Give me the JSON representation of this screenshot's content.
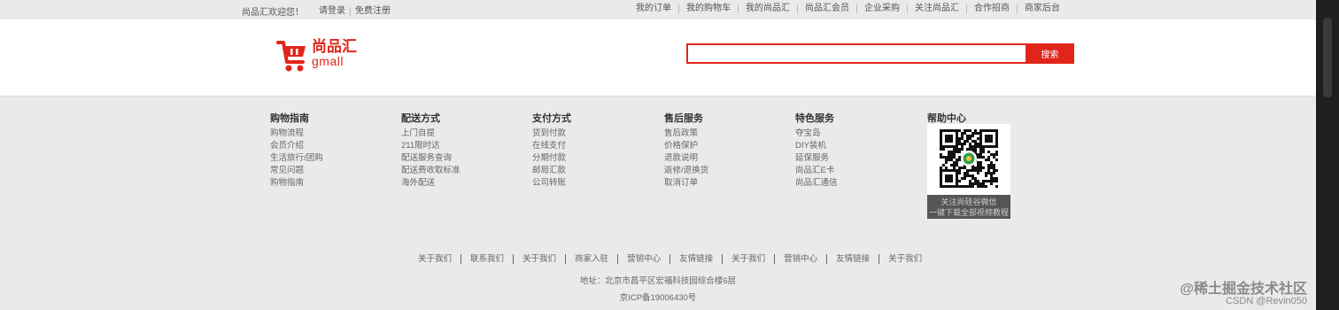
{
  "topbar": {
    "welcome": "尚品汇欢迎您！",
    "login": "请登录",
    "register": "免费注册",
    "links": [
      "我的订单",
      "我的购物车",
      "我的尚品汇",
      "尚品汇会员",
      "企业采购",
      "关注尚品汇",
      "合作招商",
      "商家后台"
    ]
  },
  "logo": {
    "cn": "尚品汇",
    "en": "gmall"
  },
  "search": {
    "placeholder": "",
    "value": "",
    "button": "搜索"
  },
  "guide": {
    "columns": [
      {
        "title": "购物指南",
        "items": [
          "购物流程",
          "会员介绍",
          "生活旅行/团购",
          "常见问题",
          "购物指南"
        ]
      },
      {
        "title": "配送方式",
        "items": [
          "上门自提",
          "211限时达",
          "配送服务查询",
          "配送费收取标准",
          "海外配送"
        ]
      },
      {
        "title": "支付方式",
        "items": [
          "货到付款",
          "在线支付",
          "分期付款",
          "邮局汇款",
          "公司转账"
        ]
      },
      {
        "title": "售后服务",
        "items": [
          "售后政策",
          "价格保护",
          "退款说明",
          "返修/退换货",
          "取消订单"
        ]
      },
      {
        "title": "特色服务",
        "items": [
          "夺宝岛",
          "DIY装机",
          "延保服务",
          "尚品汇E卡",
          "尚品汇通信"
        ]
      }
    ],
    "help": {
      "title": "帮助中心",
      "caption1": "关注尚硅谷微信",
      "caption2": "一键下载全部视频教程"
    }
  },
  "bottom": {
    "links": [
      "关于我们",
      "联系我们",
      "关于我们",
      "商家入驻",
      "营销中心",
      "友情链接",
      "关于我们",
      "营销中心",
      "友情链接",
      "关于我们"
    ],
    "address": "地址：北京市昌平区宏福科技园综合楼6层",
    "icp": "京ICP备19006430号"
  },
  "watermark": {
    "line1": "@稀土掘金技术社区",
    "line2": "CSDN @Revin050"
  },
  "colors": {
    "accent": "#e1251b",
    "background": "#eaeaea"
  }
}
